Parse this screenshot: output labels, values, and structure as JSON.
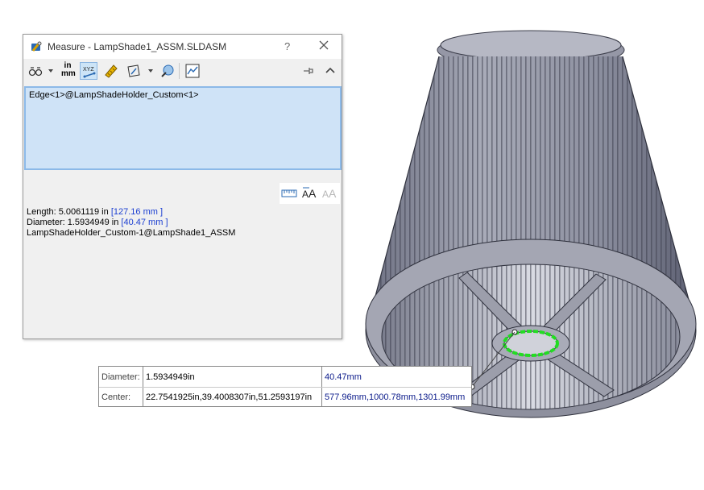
{
  "dialog": {
    "title": "Measure - LampShade1_ASSM.SLDASM",
    "help": "?",
    "toolbar": {
      "icons": [
        "arc-circle-measure-icon",
        "units-precision-icon",
        "show-xyz-icon",
        "point-to-point-icon",
        "projected-on-icon",
        "sensor-icon",
        "measurement-history-icon",
        "pin-icon",
        "collapse-icon"
      ],
      "units_label_top": "in",
      "units_label_bottom": "mm"
    },
    "selection_item": "Edge<1>@LampShadeHolder_Custom<1>",
    "results": {
      "length_label": "Length: 5.0061119 in",
      "length_alt": "[127.16 mm ]",
      "diameter_label": "Diameter: 1.5934949 in",
      "diameter_alt": "[40.47 mm ]",
      "component": "LampShadeHolder_Custom-1@LampShade1_ASSM"
    },
    "result_tools": [
      "ruler-icon",
      "text-size-icon",
      "text-size-disabled-icon"
    ]
  },
  "callout": {
    "rows": [
      {
        "label": "Diameter:",
        "value1": "1.5934949in",
        "value2": "40.47mm"
      },
      {
        "label": "Center:",
        "value1": "22.7541925in,39.4008307in,51.2593197in",
        "value2": "577.96mm,1000.78mm,1301.99mm"
      }
    ]
  },
  "colors": {
    "selection_bg": "#cfe3f7",
    "accent_blue": "#1c3fd1",
    "highlight_edge": "#22dd22",
    "model_gray": "#8a8c9a"
  }
}
